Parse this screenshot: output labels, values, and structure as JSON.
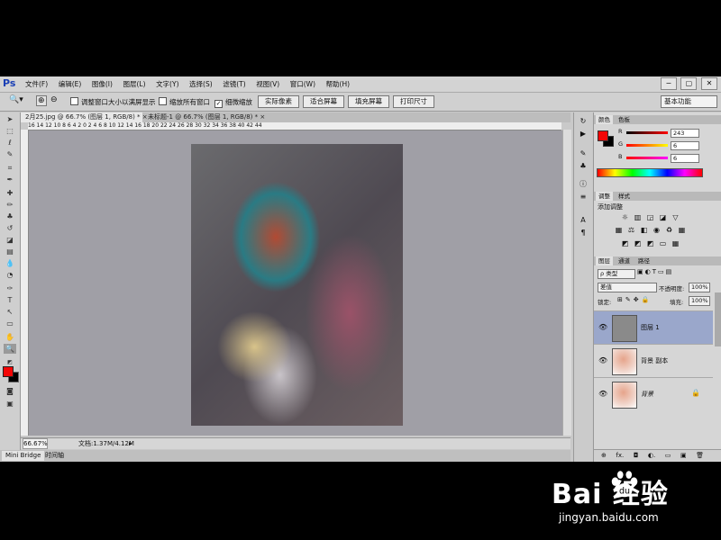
{
  "app": {
    "logo": "Ps"
  },
  "menu": [
    "文件(F)",
    "编辑(E)",
    "图像(I)",
    "图层(L)",
    "文字(Y)",
    "选择(S)",
    "滤镜(T)",
    "视图(V)",
    "窗口(W)",
    "帮助(H)"
  ],
  "window_controls": [
    "−",
    "▢",
    "✕"
  ],
  "options": {
    "check_resize": "调整窗口大小以满屏显示",
    "check_all_windows": "缩放所有窗口",
    "check_scrubby": "细微缩放",
    "btn_actual": "实际像素",
    "btn_fit": "适合屏幕",
    "btn_fill": "填充屏幕",
    "btn_print": "打印尺寸",
    "workspace": "基本功能"
  },
  "doc_tabs": [
    "2月25.jpg @ 66.7% (图层 1, RGB/8) *  ×",
    "未标题-1 @ 66.7% (图层 1, RGB/8) *  ×"
  ],
  "ruler_ticks": "16  14  12  10  8  6  4  2  0  2  4  6  8  10  12  14  16  18  20  22  24  26  28  30  32  34  36  38  40  42  44",
  "status": {
    "zoom": "66.67%",
    "doc": "文档:1.37M/4.12M"
  },
  "bottom_tabs": [
    "Mini Bridge",
    "时间轴"
  ],
  "color_panel": {
    "tabs": [
      "颜色",
      "色板"
    ],
    "r_label": "R",
    "g_label": "G",
    "b_label": "B",
    "r": "243",
    "g": "6",
    "b": "6",
    "fg_color": "#f30606",
    "bg_color": "#000000"
  },
  "adjust_panel": {
    "tabs": [
      "调整",
      "样式"
    ],
    "title": "添加调整"
  },
  "layers_panel": {
    "tabs": [
      "图层",
      "通道",
      "路径"
    ],
    "kind": "ρ 类型",
    "blend": "差值",
    "opacity_label": "不透明度:",
    "opacity": "100%",
    "lock_label": "锁定:",
    "fill_label": "填充:",
    "fill": "100%",
    "layers": [
      {
        "name": "图层 1",
        "selected": true
      },
      {
        "name": "背景 副本",
        "selected": false
      },
      {
        "name": "背景",
        "selected": false
      }
    ],
    "footer": [
      "⊕",
      "fx.",
      "◘",
      "◐.",
      "▭",
      "▣",
      "🗑"
    ]
  },
  "watermark": {
    "brand": "Bai  经验",
    "url": "jingyan.baidu.com"
  }
}
